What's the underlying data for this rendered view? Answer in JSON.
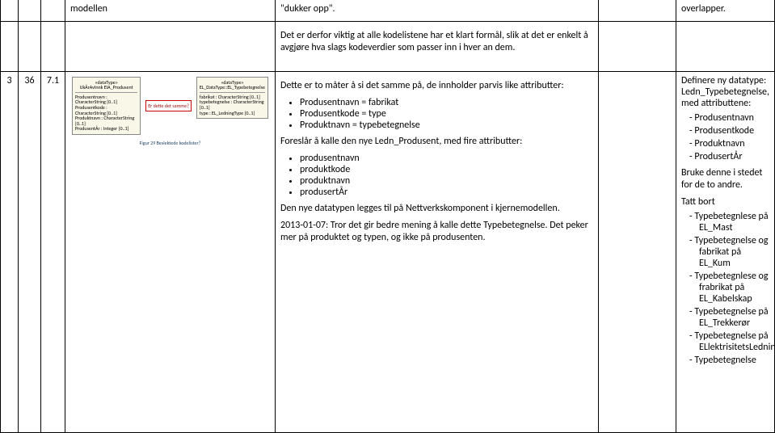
{
  "row1": {
    "c3": "modellen",
    "c4": "\"dukker opp\".",
    "c6": "overlapper."
  },
  "row2": {
    "c4_para": "Det er derfor viktig at alle kodelistene har et klart formål, slik at det er enkelt å avgjøre hva slags kodeverdier som passer inn i hver an dem."
  },
  "row3": {
    "c0": "3",
    "c1": "36",
    "c2": "7.1",
    "fig": {
      "left_title": "«dataType»\nUkÅrAvInnk EIA_Produsent",
      "left_attrs": [
        "Produsentnavn : CharacterString [0..1]",
        "Produsentkode : CharacterString [0..1]",
        "Produktnavn : CharacterString [0..1]",
        "ProdusentÅr : Integer [0..1]"
      ],
      "mid_label": "Er dette det samme?",
      "right_title": "«dataType»\nEL_DataType::EL_Typebetegnelse",
      "right_attrs": [
        "fabrikat : CharacterString [0..1]",
        "typebetegnelse : CharacterString [0..1]",
        "type : EL_LedningType [0..1]"
      ],
      "caption": "Figur 29 Beslektede kodelister?"
    },
    "c4": {
      "intro": "Dette er to måter å si det samme på, de innholder parvis like attributter:",
      "list1": [
        "Produsentnavn = fabrikat",
        "Produsentkode = type",
        "Produktnavn = typebetegnelse"
      ],
      "mid1": "Foreslår å kalle den nye Ledn_Produsent, med fire attributter:",
      "list2": [
        "produsentnavn",
        "produktkode",
        "produktnavn",
        "produsertÅr"
      ],
      "p3": "Den nye datatypen legges til på Nettverkskomponent i kjernemodellen.",
      "p4": "2013-01-07: Tror det gir bedre mening å kalle dette Typebetegnelse. Det peker mer på produktet og typen, og ikke på produsenten."
    },
    "c6": {
      "intro": "Definere ny datatype: Ledn_Typebetegnelse, med attributtene:",
      "list1": [
        "Produsentnavn",
        "Produsentkode",
        "Produktnavn",
        "ProdusertÅr"
      ],
      "mid": "Bruke denne i stedet for de to andre.",
      "tb_label": "Tatt bort",
      "list2": [
        "Typebetegnlese på EL_Mast",
        "Typebetegnelse og fabrikat på EL_Kum",
        "Typebetegnlese og frabrikat  på EL_Kabelskap",
        "Typebetegnelse på EL_Trekkerør",
        "Typebetegnelse på ELlektrisitetsLedning",
        "Typebetegnelse"
      ]
    }
  }
}
